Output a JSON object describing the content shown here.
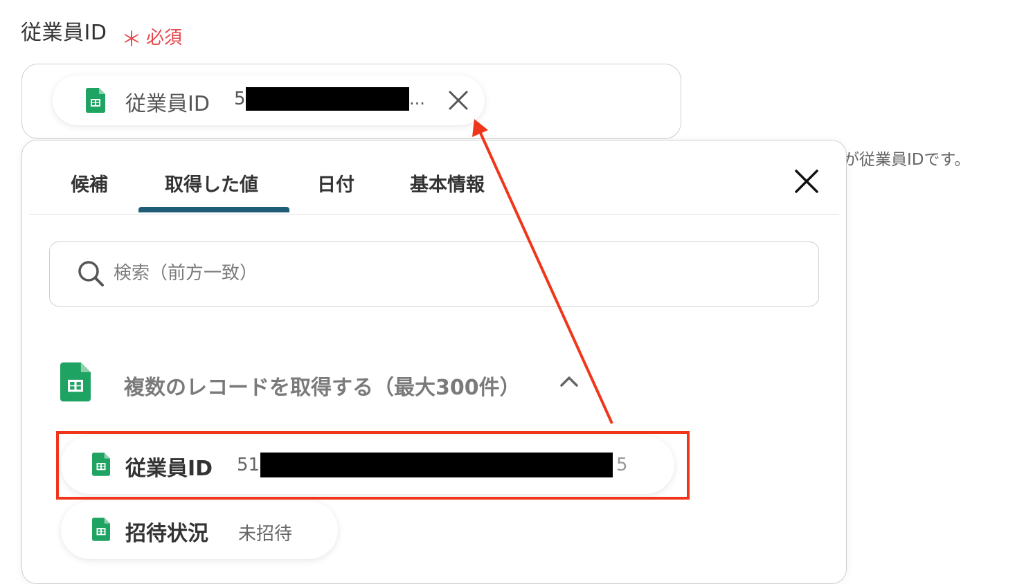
{
  "field": {
    "label": "従業員ID",
    "required_mark": "＊",
    "required_label": "必須",
    "helper_text": "が従業員IDです。"
  },
  "selected_chip": {
    "icon": "google-sheets-icon",
    "label": "従業員ID",
    "value_prefix": "5",
    "value_suffix": "...",
    "value_redacted": true
  },
  "popup": {
    "tabs": [
      {
        "label": "候補"
      },
      {
        "label": "取得した値",
        "active": true
      },
      {
        "label": "日付"
      },
      {
        "label": "基本情報"
      }
    ],
    "search": {
      "placeholder": "検索（前方一致）",
      "value": ""
    },
    "group": {
      "icon": "google-sheets-icon",
      "title": "複数のレコードを取得する（最大300件）",
      "expanded": true
    },
    "items": [
      {
        "label": "従業員ID",
        "value": "51",
        "value_tail": "5",
        "value_redacted": true,
        "highlighted": true
      },
      {
        "label": "招待状況",
        "value": "未招待"
      }
    ]
  },
  "colors": {
    "accent_tab": "#1f5d76",
    "required": "#e5484d",
    "annotation": "#f0361a",
    "sheets_green": "#1ea362"
  }
}
